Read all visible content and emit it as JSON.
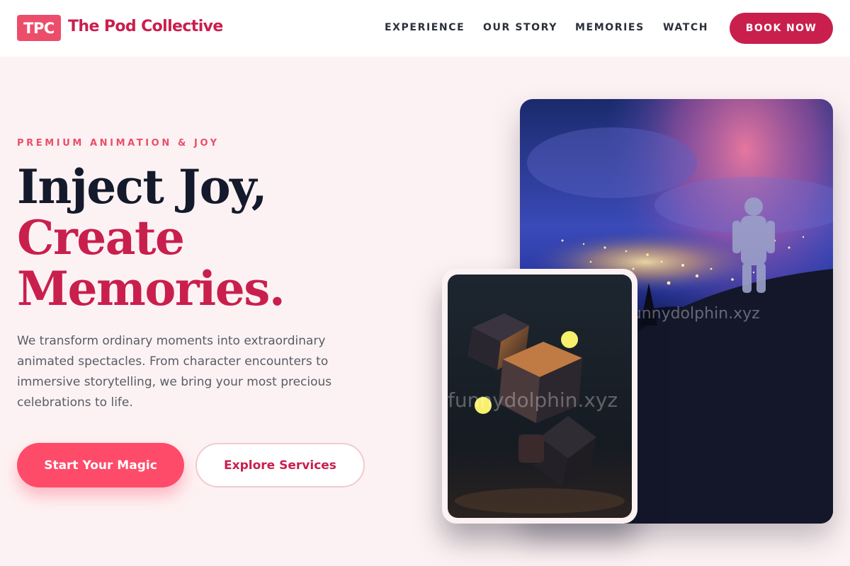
{
  "brand": {
    "badge": "TPC",
    "name": "The Pod Collective",
    "color": "#c91f4d",
    "badge_color": "#ec4d6b"
  },
  "nav": {
    "items": [
      "EXPERIENCE",
      "OUR STORY",
      "MEMORIES",
      "WATCH"
    ],
    "cta": "BOOK NOW"
  },
  "hero": {
    "eyebrow": "PREMIUM ANIMATION & JOY",
    "headline": [
      "Inject Joy,",
      "Create",
      "Memories."
    ],
    "description": "We transform ordinary moments into extraordinary animated spectacles. From character encounters to immersive storytelling, we bring your most precious celebrations to life.",
    "primary_button": "Start Your Magic",
    "secondary_button": "Explore Services",
    "accent_color": "#fe4b69"
  },
  "images": {
    "large": {
      "subject": "astronaut overlooking city lights at night",
      "watermark": "funnydolphin.xyz"
    },
    "small": {
      "subject": "floating dark cubes with glowing yellow spheres",
      "watermark": "funnydolphin.xyz"
    }
  }
}
